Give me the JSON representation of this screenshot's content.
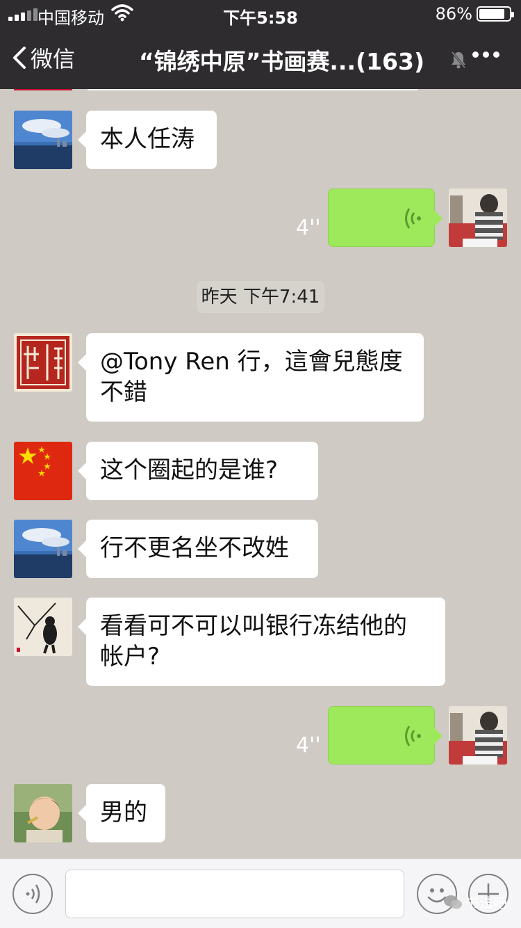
{
  "status_bar": {
    "carrier": "中国移动",
    "time": "下午5:58",
    "battery": "86%",
    "battery_level": 0.86
  },
  "nav": {
    "back_label": "微信",
    "title": "“锦绣中原”书画赛...(163)"
  },
  "messages": [
    {
      "side": "left",
      "avatar": "sea-landscape-avatar",
      "text": "本人任涛"
    },
    {
      "side": "right",
      "type": "voice",
      "duration": "4''"
    },
    {
      "side": "left",
      "avatar": "red-seal-avatar",
      "text": "@Tony Ren 行，這會兒態度不錯",
      "text_line1": "@Tony Ren 行，這會兒態度",
      "text_line2": "不錯"
    },
    {
      "side": "left",
      "avatar": "china-flag-avatar",
      "text": "这个圈起的是谁?"
    },
    {
      "side": "left",
      "avatar": "sea-landscape-avatar",
      "text": "行不更名坐不改姓"
    },
    {
      "side": "left",
      "avatar": "bird-painting-avatar",
      "text": "看看可不可以叫银行冻结他的帐户?",
      "text_line1": "看看可不可以叫银行冻结他的",
      "text_line2": "帐户?"
    },
    {
      "side": "right",
      "type": "voice",
      "duration": "4''"
    },
    {
      "side": "left",
      "avatar": "child-photo-avatar",
      "text": "男的"
    }
  ],
  "timestamp": "昨天 下午7:41",
  "watermark": "书法吧",
  "colors": {
    "nav_bg": "#2e2c2f",
    "chat_bg": "#cfcac3",
    "voice_bubble": "#9ee85b",
    "input_bar": "#f5f5f7"
  }
}
